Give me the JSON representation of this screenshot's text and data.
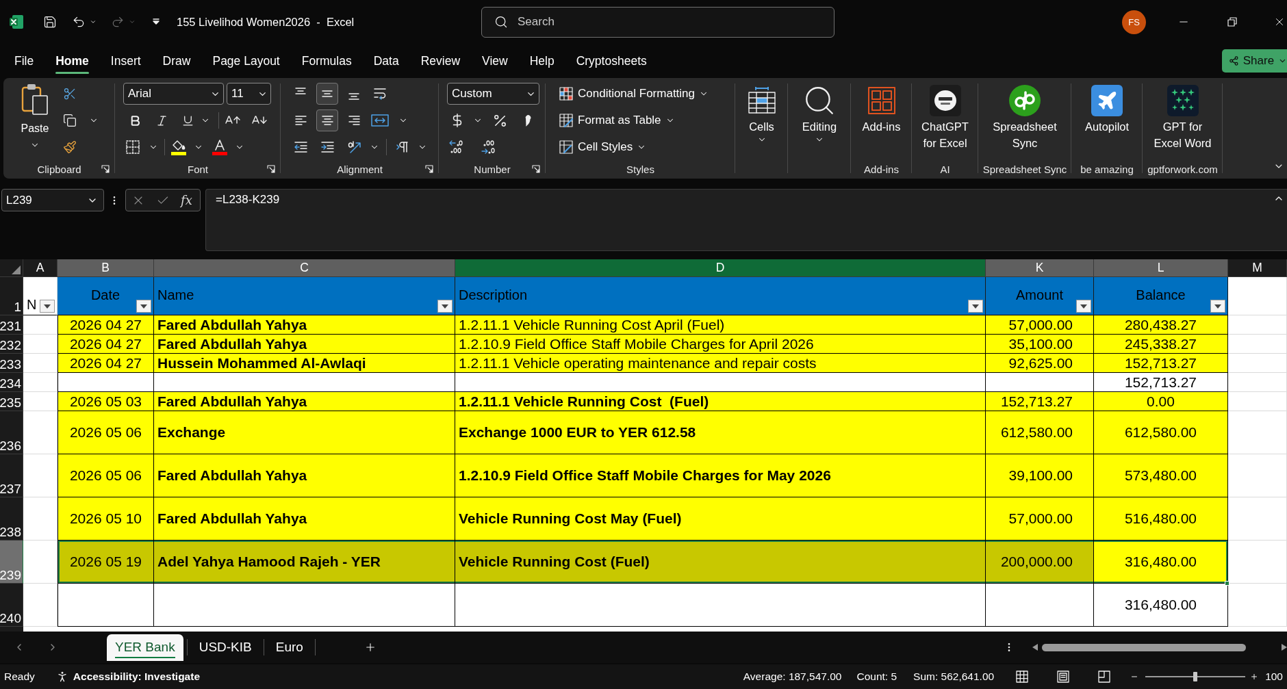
{
  "window": {
    "title": "155 Livelihod Women2026  -  Excel",
    "user_initials": "FS"
  },
  "search": {
    "placeholder": "Search"
  },
  "quick_access": {
    "undo_disabled": false,
    "redo_disabled": true
  },
  "menu_tabs": [
    {
      "label": "File",
      "selected": false
    },
    {
      "label": "Home",
      "selected": true
    },
    {
      "label": "Insert",
      "selected": false
    },
    {
      "label": "Draw",
      "selected": false
    },
    {
      "label": "Page Layout",
      "selected": false
    },
    {
      "label": "Formulas",
      "selected": false
    },
    {
      "label": "Data",
      "selected": false
    },
    {
      "label": "Review",
      "selected": false
    },
    {
      "label": "View",
      "selected": false
    },
    {
      "label": "Help",
      "selected": false
    },
    {
      "label": "Cryptosheets",
      "selected": false
    }
  ],
  "share_button": {
    "label": "Share"
  },
  "ribbon": {
    "clipboard": {
      "paste_label": "Paste",
      "group_label": "Clipboard"
    },
    "font": {
      "font_name": "Arial",
      "font_size": "11",
      "group_label": "Font"
    },
    "alignment": {
      "vertical": [
        {
          "kind": "top",
          "selected": false
        },
        {
          "kind": "middle",
          "selected": true
        },
        {
          "kind": "bottom",
          "selected": false
        }
      ],
      "horizontal": [
        {
          "kind": "left",
          "selected": false
        },
        {
          "kind": "center",
          "selected": true
        },
        {
          "kind": "right",
          "selected": false
        }
      ],
      "group_label": "Alignment"
    },
    "number": {
      "format": "Custom",
      "group_label": "Number"
    },
    "styles": {
      "items": [
        {
          "kind": "conditional",
          "label": "Conditional Formatting"
        },
        {
          "kind": "table",
          "label": "Format as Table"
        },
        {
          "kind": "cell",
          "label": "Cell Styles"
        }
      ],
      "group_label": "Styles"
    },
    "big_groups": [
      {
        "kind": "cells",
        "button": [
          "Cells"
        ],
        "dropdown": true
      },
      {
        "kind": "editing",
        "button": [
          "Editing"
        ],
        "dropdown": true
      },
      {
        "kind": "addins",
        "button": [
          "Add-ins"
        ],
        "dropdown": false,
        "group_label": "Add-ins"
      },
      {
        "kind": "chatgpt",
        "button": [
          "ChatGPT",
          "for Excel"
        ],
        "dropdown": false,
        "group_label": "AI"
      },
      {
        "kind": "sync",
        "button": [
          "Spreadsheet",
          "Sync"
        ],
        "dropdown": false,
        "group_label": "Spreadsheet Sync"
      },
      {
        "kind": "autopilot",
        "button": [
          "Autopilot"
        ],
        "dropdown": false,
        "group_label": "be amazing"
      },
      {
        "kind": "gptforwork",
        "button": [
          "GPT for",
          "Excel Word"
        ],
        "dropdown": false,
        "group_label": "gptforwork.com"
      }
    ]
  },
  "formula_bar": {
    "name_box": "L239",
    "function_label": "fx",
    "formula": "=L238-K239"
  },
  "sheet": {
    "columns": [
      {
        "label": "A",
        "selected": false,
        "highlighted": false
      },
      {
        "label": "B",
        "selected": true,
        "highlighted": false
      },
      {
        "label": "C",
        "selected": true,
        "highlighted": false
      },
      {
        "label": "D",
        "selected": true,
        "highlighted": true
      },
      {
        "label": "K",
        "selected": true,
        "highlighted": false
      },
      {
        "label": "L",
        "selected": true,
        "highlighted": false
      },
      {
        "label": "M",
        "selected": false,
        "highlighted": false
      }
    ],
    "header_row": {
      "number": "1",
      "cells": [
        {
          "text": "N",
          "filter": true
        },
        {
          "text": "Date",
          "filter": true
        },
        {
          "text": "Name",
          "filter": true
        },
        {
          "text": "Description",
          "filter": true
        },
        {
          "text": "Amount",
          "filter": true
        },
        {
          "text": "Balance",
          "filter": true
        }
      ]
    },
    "rows": [
      {
        "number": "231",
        "selected": false,
        "highlighted": true,
        "description_bold": false,
        "cells": {
          "date": "2026 04 27",
          "name": "Fared Abdullah Yahya",
          "description": "1.2.11.1 Vehicle Running Cost April (Fuel)",
          "amount": "57,000.00",
          "balance": "280,438.27"
        }
      },
      {
        "number": "232",
        "selected": false,
        "highlighted": true,
        "description_bold": false,
        "cells": {
          "date": "2026 04 27",
          "name": "Fared Abdullah Yahya",
          "description": "1.2.10.9 Field Office Staff Mobile Charges for April 2026",
          "amount": "35,100.00",
          "balance": "245,338.27"
        }
      },
      {
        "number": "233",
        "selected": false,
        "highlighted": true,
        "description_bold": false,
        "cells": {
          "date": "2026 04 27",
          "name": "Hussein Mohammed Al-Awlaqi",
          "description": "1.2.11.1 Vehicle operating maintenance and repair costs",
          "amount": "92,625.00",
          "balance": "152,713.27"
        }
      },
      {
        "number": "234",
        "selected": false,
        "highlighted": false,
        "cells": {
          "balance": "152,713.27"
        }
      },
      {
        "number": "235",
        "selected": false,
        "highlighted": true,
        "description_bold": true,
        "cells": {
          "date": "2026 05 03",
          "name": "Fared Abdullah Yahya",
          "description": "1.2.11.1 Vehicle Running Cost  (Fuel)",
          "amount": "152,713.27",
          "balance": "0.00"
        }
      },
      {
        "number": "236",
        "selected": false,
        "highlighted": true,
        "description_bold": true,
        "cells": {
          "date": "2026 05 06",
          "name": "Exchange",
          "description": "Exchange 1000 EUR to YER 612.58",
          "amount": "612,580.00",
          "balance": "612,580.00"
        }
      },
      {
        "number": "237",
        "selected": false,
        "highlighted": true,
        "description_bold": true,
        "cells": {
          "date": "2026 05 06",
          "name": "Fared Abdullah Yahya",
          "description": "1.2.10.9 Field Office Staff Mobile Charges for May 2026",
          "amount": "39,100.00",
          "balance": "573,480.00"
        }
      },
      {
        "number": "238",
        "selected": false,
        "highlighted": true,
        "description_bold": true,
        "cells": {
          "date": "2026 05 10",
          "name": "Fared Abdullah Yahya",
          "description": "Vehicle Running Cost May (Fuel)",
          "amount": "57,000.00",
          "balance": "516,480.00"
        }
      },
      {
        "number": "239",
        "selected": true,
        "highlighted": true,
        "description_bold": true,
        "cells": {
          "date": "2026 05 19",
          "name": "Adel Yahya Hamood Rajeh - YER",
          "description": "Vehicle Running Cost (Fuel)",
          "amount": "200,000.00",
          "balance": "316,480.00"
        }
      },
      {
        "number": "240",
        "selected": false,
        "highlighted": false,
        "cells": {
          "balance": "316,480.00"
        }
      }
    ]
  },
  "sheet_tabs": [
    {
      "label": "YER Bank",
      "selected": true
    },
    {
      "label": "USD-KIB",
      "selected": false
    },
    {
      "label": "Euro",
      "selected": false
    }
  ],
  "status_bar": {
    "mode": "Ready",
    "accessibility": "Accessibility: Investigate",
    "average": "Average: 187,547.00",
    "count": "Count: 5",
    "sum": "Sum: 562,641.00",
    "zoom": {
      "level": 0.5,
      "label": "100"
    }
  }
}
